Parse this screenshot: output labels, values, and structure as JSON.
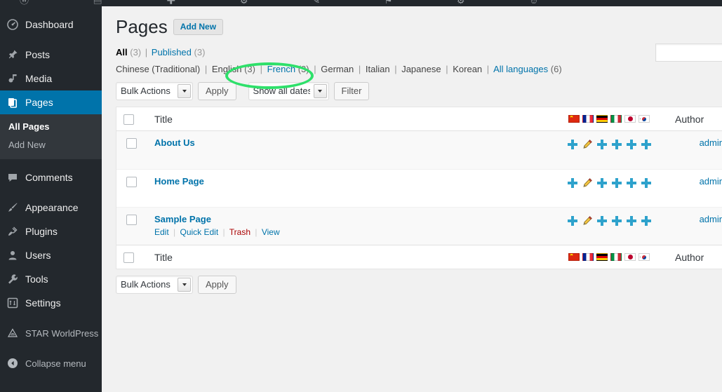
{
  "adminbar": {
    "icons": "ⓦ ▤ ✚ ⚙ ✎ ⚑ ⚙ ☺"
  },
  "sidebar": {
    "items": [
      {
        "label": "Dashboard",
        "icon": "dashboard-icon",
        "active": false
      },
      {
        "label": "Posts",
        "icon": "pin-icon",
        "active": false
      },
      {
        "label": "Media",
        "icon": "media-icon",
        "active": false
      },
      {
        "label": "Pages",
        "icon": "pages-icon",
        "active": true
      },
      {
        "label": "Comments",
        "icon": "comment-icon",
        "active": false
      },
      {
        "label": "Appearance",
        "icon": "brush-icon",
        "active": false
      },
      {
        "label": "Plugins",
        "icon": "plug-icon",
        "active": false
      },
      {
        "label": "Users",
        "icon": "user-icon",
        "active": false
      },
      {
        "label": "Tools",
        "icon": "wrench-icon",
        "active": false
      },
      {
        "label": "Settings",
        "icon": "settings-icon",
        "active": false
      },
      {
        "label": "STAR WorldPress",
        "icon": "triangle-icon",
        "active": false
      },
      {
        "label": "Collapse menu",
        "icon": "collapse-icon",
        "active": false
      }
    ],
    "submenu": {
      "all_pages": "All Pages",
      "add_new": "Add New"
    },
    "active_color": "#0073aa",
    "bg_color": "#23282d"
  },
  "header": {
    "title": "Pages",
    "add_new_label": "Add New"
  },
  "search": {
    "value": "",
    "placeholder": ""
  },
  "status_filter": {
    "all_label": "All",
    "all_count": "(3)",
    "published_label": "Published",
    "published_count": "(3)",
    "separator": "|"
  },
  "language_filter": {
    "separator": "|",
    "items": [
      {
        "label": "Chinese (Traditional)",
        "count": "",
        "link": false,
        "current": false
      },
      {
        "label": "English",
        "count": "(3)",
        "link": false,
        "current": true
      },
      {
        "label": "French",
        "count": "(3)",
        "link": true,
        "current": false
      },
      {
        "label": "German",
        "count": "",
        "link": false,
        "current": false
      },
      {
        "label": "Italian",
        "count": "",
        "link": false,
        "current": false
      },
      {
        "label": "Japanese",
        "count": "",
        "link": false,
        "current": false
      },
      {
        "label": "Korean",
        "count": "",
        "link": false,
        "current": false
      },
      {
        "label": "All languages",
        "count": "(6)",
        "link": true,
        "current": false
      }
    ]
  },
  "tablenav_top": {
    "bulk_actions_value": "Bulk Actions",
    "apply_label": "Apply",
    "dates_value": "Show all dates",
    "filter_label": "Filter"
  },
  "tablenav_bottom": {
    "bulk_actions_value": "Bulk Actions",
    "apply_label": "Apply"
  },
  "table": {
    "columns": {
      "title": "Title",
      "author": "Author"
    },
    "language_flags": [
      {
        "name": "china-flag",
        "code": "cn",
        "title": "Chinese (Traditional)"
      },
      {
        "name": "france-flag",
        "code": "fr",
        "title": "French"
      },
      {
        "name": "germany-flag",
        "code": "de",
        "title": "German"
      },
      {
        "name": "italy-flag",
        "code": "it",
        "title": "Italian"
      },
      {
        "name": "japan-flag",
        "code": "jp",
        "title": "Japanese"
      },
      {
        "name": "korea-flag",
        "code": "kr",
        "title": "Korean"
      }
    ],
    "rows": [
      {
        "title": "About Us",
        "author": "admin",
        "alt": true,
        "icons": [
          "plus-icon",
          "pencil-icon",
          "plus-icon",
          "plus-icon",
          "plus-icon",
          "plus-icon"
        ],
        "actions": []
      },
      {
        "title": "Home Page",
        "author": "admin",
        "alt": false,
        "icons": [
          "plus-icon",
          "pencil-icon",
          "plus-icon",
          "plus-icon",
          "plus-icon",
          "plus-icon"
        ],
        "actions": []
      },
      {
        "title": "Sample Page",
        "author": "admin",
        "alt": true,
        "icons": [
          "plus-icon",
          "pencil-icon",
          "plus-icon",
          "plus-icon",
          "plus-icon",
          "plus-icon"
        ],
        "actions": [
          {
            "label": "Edit",
            "kind": "edit"
          },
          {
            "label": "Quick Edit",
            "kind": "quickedit"
          },
          {
            "label": "Trash",
            "kind": "trash"
          },
          {
            "label": "View",
            "kind": "view"
          }
        ]
      }
    ]
  },
  "annotation": {
    "shape": "ellipse",
    "color": "#2ee06a",
    "targets": "French (3)"
  }
}
